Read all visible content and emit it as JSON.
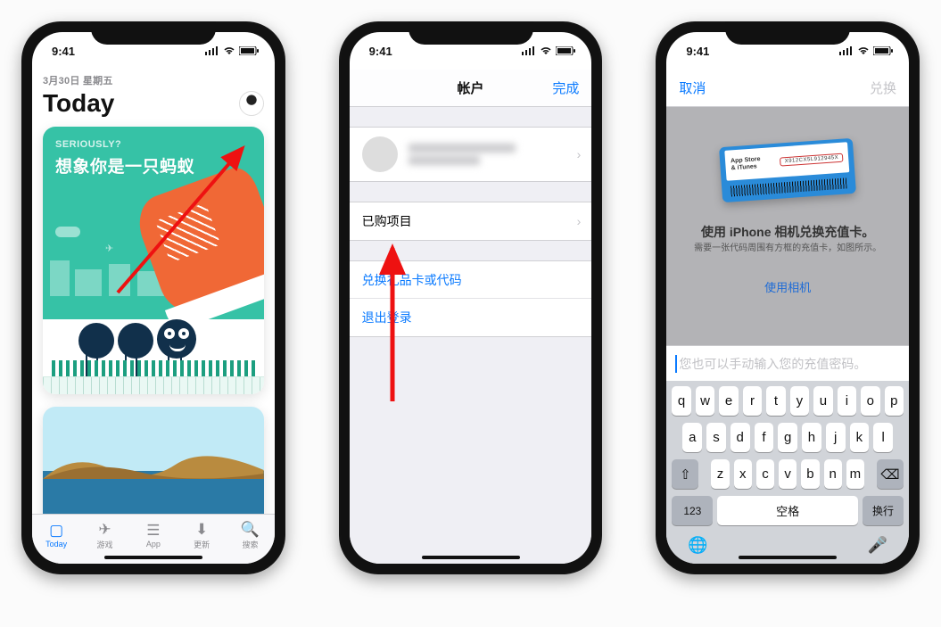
{
  "status": {
    "time": "9:41"
  },
  "phone1": {
    "date": "3月30日 星期五",
    "title": "Today",
    "card1": {
      "eyebrow": "SERIOUSLY?",
      "headline": "想象你是一只蚂蚁"
    },
    "tabs": {
      "today": "Today",
      "games": "游戏",
      "apps": "App",
      "updates": "更新",
      "search": "搜索"
    }
  },
  "phone2": {
    "nav": {
      "title": "帐户",
      "done": "完成"
    },
    "rows": {
      "purchased": "已购项目",
      "redeem": "兑换礼品卡或代码",
      "signout": "退出登录"
    }
  },
  "phone3": {
    "nav": {
      "cancel": "取消",
      "action": "兑换"
    },
    "gift": {
      "brand1": "App Store",
      "brand2": "& iTunes",
      "code": "X912CX5L912945X"
    },
    "title": "使用 iPhone 相机兑换充值卡。",
    "subtitle": "需要一张代码周围有方框的充值卡，如图所示。",
    "use_camera": "使用相机",
    "placeholder": "您也可以手动输入您的充值密码。",
    "keyboard": {
      "r1": [
        "q",
        "w",
        "e",
        "r",
        "t",
        "y",
        "u",
        "i",
        "o",
        "p"
      ],
      "r2": [
        "a",
        "s",
        "d",
        "f",
        "g",
        "h",
        "j",
        "k",
        "l"
      ],
      "r3": [
        "z",
        "x",
        "c",
        "v",
        "b",
        "n",
        "m"
      ],
      "numKey": "123",
      "space": "空格",
      "return": "换行"
    }
  }
}
